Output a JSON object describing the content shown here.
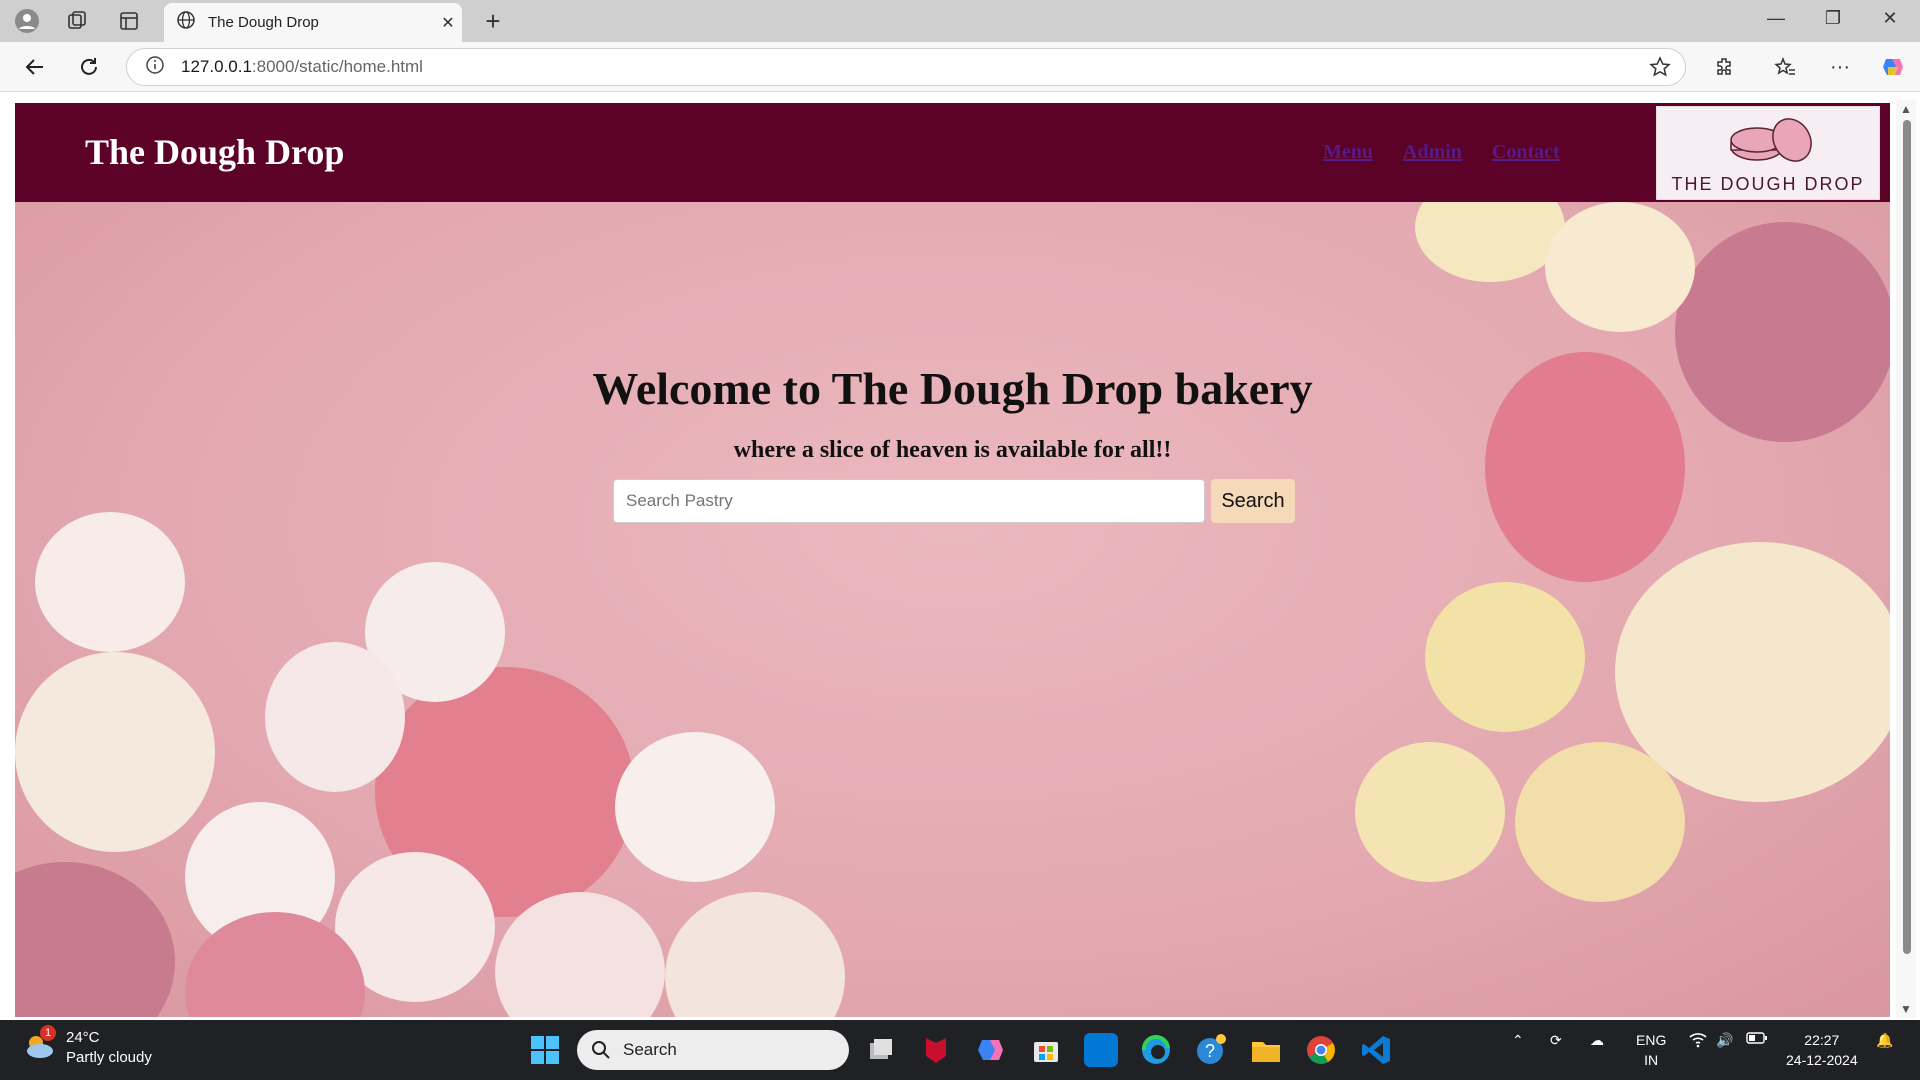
{
  "browser": {
    "tab_title": "The Dough Drop",
    "url_host": "127.0.0.1",
    "url_path": ":8000/static/home.html"
  },
  "site": {
    "title": "The Dough Drop",
    "nav": [
      "Menu",
      "Admin",
      "Contact"
    ],
    "logo_text": "THE DOUGH DROP"
  },
  "hero": {
    "heading": "Welcome to The Dough Drop bakery",
    "tagline": "where a slice of heaven is available for all!!",
    "search_placeholder": "Search Pastry",
    "search_button": "Search"
  },
  "taskbar": {
    "temperature": "24°C",
    "weather": "Partly cloudy",
    "weather_badge": "1",
    "search_label": "Search",
    "language_1": "ENG",
    "language_2": "IN",
    "time": "22:27",
    "date": "24-12-2024"
  },
  "colors": {
    "header": "#5c0127",
    "hero_bg": "#e7adb4",
    "search_button": "#f5d9b8"
  }
}
